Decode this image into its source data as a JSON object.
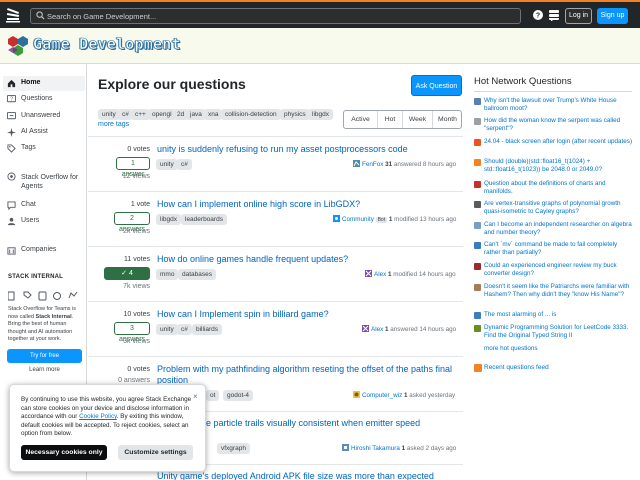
{
  "topbar": {
    "search_placeholder": "Search on Game Development...",
    "login_label": "Log in",
    "signup_label": "Sign up",
    "accent_color": "#f48225"
  },
  "site": {
    "title": "Game Development"
  },
  "sidebar": {
    "items": [
      {
        "label": "Home",
        "icon": "home-icon",
        "active": true
      },
      {
        "label": "Questions",
        "icon": "questions-icon"
      },
      {
        "label": "Unanswered",
        "icon": "unanswered-icon"
      },
      {
        "label": "AI Assist",
        "icon": "ai-assist-icon"
      },
      {
        "label": "Tags",
        "icon": "tags-icon"
      },
      {
        "label": "Stack Overflow for Agents",
        "icon": "agents-icon"
      },
      {
        "label": "Chat",
        "icon": "chat-icon"
      },
      {
        "label": "Users",
        "icon": "users-icon"
      },
      {
        "label": "Companies",
        "icon": "companies-icon"
      }
    ],
    "stack_internal": {
      "heading": "STACK INTERNAL",
      "text_pre": "Stack Overflow for Teams is now called ",
      "text_bold": "Stack Internal",
      "text_post": ". Bring the best of human thought and AI automation together at your work.",
      "try_label": "Try for free",
      "learn_label": "Learn more"
    }
  },
  "main": {
    "title": "Explore our questions",
    "ask_label": "Ask Question",
    "tags": [
      "unity",
      "c#",
      "c++",
      "opengl",
      "2d",
      "java",
      "xna",
      "collision-detection",
      "physics",
      "libgdx"
    ],
    "more_tags": "more tags",
    "filters": [
      "Active",
      "Hot",
      "Week",
      "Month"
    ],
    "questions": [
      {
        "votes": "0 votes",
        "answers": "1 answer",
        "answer_style": "bordered",
        "views": "12 views",
        "title": "unity is suddenly refusing to run my asset postprocessors code",
        "tags": [
          "unity",
          "c#"
        ],
        "user": "FenFox",
        "rep": "31",
        "action": "answered 8 hours ago"
      },
      {
        "votes": "1 vote",
        "answers": "2 answers",
        "answer_style": "bordered",
        "views": "2k views",
        "title": "How can I implement online high score in LibGDX?",
        "tags": [
          "libgdx",
          "leaderboards"
        ],
        "user": "Community",
        "badge": "Bot",
        "rep": "1",
        "action": "modified 13 hours ago"
      },
      {
        "votes": "11 votes",
        "answers": "4 answers",
        "answer_style": "accepted",
        "views": "7k views",
        "title": "How do online games handle frequent updates?",
        "tags": [
          "mmo",
          "databases"
        ],
        "user": "Alex",
        "rep": "1",
        "action": "modified 14 hours ago"
      },
      {
        "votes": "10 votes",
        "answers": "3 answers",
        "answer_style": "bordered",
        "views": "3k views",
        "title": "How can I Implement spin in billiard game?",
        "tags": [
          "unity",
          "c#",
          "billiards"
        ],
        "user": "Alex",
        "rep": "1",
        "action": "answered 14 hours ago"
      },
      {
        "votes": "0 votes",
        "answers": "0 answers",
        "answer_style": "none",
        "views": "",
        "title": "Problem with my pathfinding algorithm reseting the offset of the paths final position",
        "tags": [
          "godot",
          "godot-4"
        ],
        "tag_visible_prefix": [
          "ot",
          "godot-4"
        ],
        "user": "Computer_wiz",
        "rep": "1",
        "action": "asked yesterday"
      },
      {
        "votes": "",
        "answers": "",
        "answer_style": "none",
        "views": "",
        "title": "e particle trails visually consistent when emitter speed",
        "tags": [
          "vfxgraph"
        ],
        "user": "Hiroshi Takamura",
        "rep": "1",
        "action": "asked 2 days ago"
      },
      {
        "votes": "",
        "answers": "",
        "answer_style": "none",
        "views": "",
        "title": "Unity game's deployed Android APK file size was more than expected",
        "tags": [],
        "user": "",
        "rep": "",
        "action": ""
      }
    ]
  },
  "hot_network": {
    "title": "Hot Network Questions",
    "items": [
      {
        "text": "Why isn't the lawsuit over Trump's White House ballroom moot?",
        "color": "#5b7db7"
      },
      {
        "text": "How did the woman know the serpent was called \"serpent\"?",
        "color": "#9aa0a6"
      },
      {
        "text": "24.04 - black screen after login (after recent updates)",
        "color": "#e95420"
      },
      {
        "text": "Should (double)(std::float16_t(1024) + std::float16_t(1023)) be 2048.0 or 2049.0?",
        "color": "#f48225"
      },
      {
        "text": "Question about the definitions of charts and manifolds.",
        "color": "#c4302b"
      },
      {
        "text": "Are vertex-transitive graphs of polynomial growth quasi-isometric to Cayley graphs?",
        "color": "#5a5a5a"
      },
      {
        "text": "Can I become an independent researcher on algebra and number theory?",
        "color": "#7a9fc4"
      },
      {
        "text": "Can't `mv` command be made to fail completely rather than partially?",
        "color": "#3b7bbf"
      },
      {
        "text": "Could an experienced engineer review my buck converter design?",
        "color": "#9c2a2a"
      },
      {
        "text": "Doesn't it seem like the Patriarchs were familiar with Hashem? Then why didn't they \"know His Name\"?",
        "color": "#a67c52"
      },
      {
        "text": "The most alarming of ... is",
        "color": "#3c7ebf"
      },
      {
        "text": "Dynamic Programming Solution for LeetCode 3333. Find the Original Typed String II",
        "color": "#6b8e23"
      },
      {
        "text": "more hot questions",
        "color": ""
      }
    ],
    "rss_label": "Recent questions feed"
  },
  "cookie": {
    "text_pre": "By continuing to use this website, you agree Stack Exchange can store cookies on your device and disclose information in accordance with our ",
    "link": "Cookie Policy",
    "text_post": ". By exiting this window, default cookies will be accepted. To reject cookies, select an option from below.",
    "close": "×",
    "necessary_label": "Necessary cookies only",
    "customize_label": "Customize settings"
  }
}
